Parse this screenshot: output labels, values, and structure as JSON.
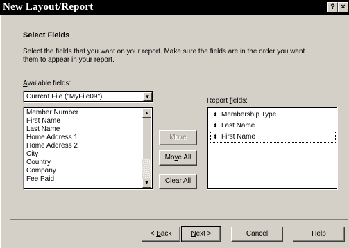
{
  "window": {
    "title": "New Layout/Report",
    "help_glyph": "?",
    "close_glyph": "×"
  },
  "step": {
    "heading": "Select Fields",
    "description": "Select the fields that you want on your report. Make sure the fields are in the order you want them to appear in your report."
  },
  "available": {
    "label": "Available fields:",
    "file_selector": "Current File (\"MyFile09\")",
    "fields": [
      "Member Number",
      "First Name",
      "Last Name",
      "Home Address 1",
      "Home Address 2",
      "City",
      "Country",
      "Company",
      "Fee Paid"
    ]
  },
  "report": {
    "label": "Report fields:",
    "fields": [
      "Membership Type",
      "Last Name",
      "First Name"
    ]
  },
  "buttons": {
    "move": "Move",
    "move_all": "Move All",
    "clear_all": "Clear All",
    "back": "< Back",
    "next": "Next >",
    "cancel": "Cancel",
    "help": "Help"
  },
  "icons": {
    "dropdown_arrow": "▼",
    "scroll_up": "▲",
    "scroll_down": "▼",
    "reorder_arrows": "⬍"
  }
}
